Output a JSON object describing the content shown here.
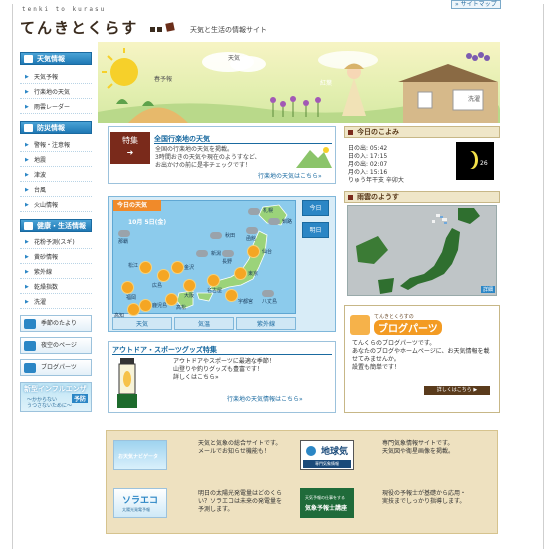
{
  "header": {
    "logo_small": "tenki to kurasu",
    "logo": "てんきとくらす",
    "tagline": "天気と生活の情報サイト",
    "sitemap": "» サイトマップ"
  },
  "sidebar": {
    "sections": [
      {
        "title": "天気情報",
        "items": [
          "天気予報",
          "行楽地の天気",
          "雨雲レーダー"
        ]
      },
      {
        "title": "防災情報",
        "items": [
          "警報・注意報",
          "地震",
          "津波",
          "台風",
          "火山情報"
        ]
      },
      {
        "title": "健康・生活情報",
        "items": [
          "花粉予測(スギ)",
          "黄砂情報",
          "紫外線",
          "乾燥指数",
          "洗濯"
        ]
      }
    ],
    "buttons": [
      "季節のたより",
      "夜空のページ",
      "ブログパーツ"
    ],
    "flu": {
      "title": "新型インフルエンザ",
      "sub": "～かからない\nうつさないために～",
      "badge": "予防"
    }
  },
  "hero": {
    "labels": [
      "天気",
      "春予報",
      "紅葉",
      "洗濯"
    ]
  },
  "special": {
    "tab": "特集",
    "title": "全国行楽地の天気",
    "desc": "全国の行楽地の天気を掲載。\n3時間おきの天気や現在のようすなど、\nお出かけの前に是非チェックです！",
    "link": "行楽地の天気はこちら»"
  },
  "koyomi": {
    "title": "今日のこよみ",
    "rows": [
      "日の出: 05:42",
      "日の入: 17:15",
      "月の出: 02:07",
      "月の入: 15:16",
      "りゅう年干支 辛卯大"
    ],
    "moon_age": "26"
  },
  "today": {
    "label": "今日の天気",
    "date": "10月 5日(金)",
    "side": [
      "今日",
      "明日"
    ],
    "tabs": [
      "天気",
      "気温",
      "紫外線"
    ],
    "cities": [
      "札幌",
      "釧路",
      "函館",
      "秋田",
      "仙台",
      "新潟",
      "金沢",
      "東京",
      "名古屋",
      "大阪",
      "広島",
      "福岡",
      "鹿児島",
      "那覇",
      "松江",
      "高松",
      "高知",
      "長野",
      "宇都宮",
      "八丈島"
    ]
  },
  "radar": {
    "title": "雨雲のようす",
    "more": "詳細"
  },
  "outdoor": {
    "title": "アウトドア・スポーツグッズ特集",
    "desc": "アウトドアやスポーツに最適な季節！\n山登りや釣りグッズも豊富です！\n詳しくはこちら»",
    "link": "行楽地の天気情報はこちら»"
  },
  "blogparts": {
    "small": "てんきとくらすの",
    "title": "ブログパーツ",
    "desc": "てんくらのブログパーツです。\nあなたのブログやホームページに、お天気情報を載せてみませんか。\n設置も簡単です！",
    "button": "詳しくはこちら ▶"
  },
  "bottom": {
    "items": [
      {
        "img": "お天気ナビゲータ",
        "text": "天気と気象の総合サイトです。\nメールでお知らせ機能も！"
      },
      {
        "img": "地球気",
        "img_sub": "専門気象情報",
        "text": "専門気象情報サイトです。\n天気図や衛星画像を掲載。"
      },
      {
        "img": "ソラエコ",
        "img_sub": "太陽光発電予報",
        "text": "明日の太陽光発電量はどのくらい？ソラエコは未来の発電量を予測します。"
      },
      {
        "img": "気象予報士講座",
        "img_sub": "天気予報の仕事をする",
        "text": "現役の予報士が基礎から応用・実技までしっかり指導します。"
      }
    ]
  },
  "colors": {
    "accent": "#2b86c5",
    "brown": "#7a2a1b",
    "orange": "#f39b23"
  }
}
